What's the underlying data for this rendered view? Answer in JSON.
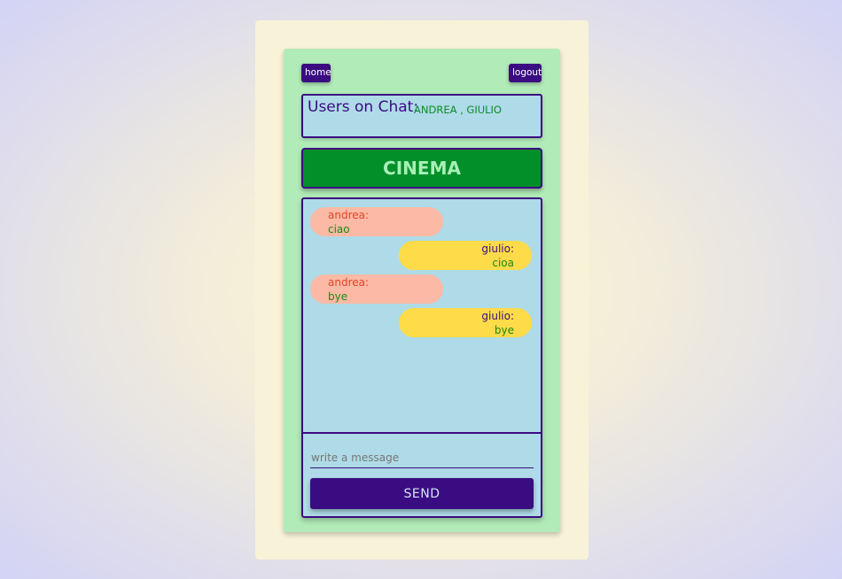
{
  "nav": {
    "home_label": "home",
    "logout_label": "logout"
  },
  "users": {
    "label": "Users on Chat:",
    "list": "ANDREA , GIULIO"
  },
  "room": {
    "name": "CINEMA"
  },
  "messages": [
    {
      "sender": "andrea:",
      "text": "ciao",
      "side": "left"
    },
    {
      "sender": "giulio:",
      "text": "cioa",
      "side": "right"
    },
    {
      "sender": "andrea:",
      "text": "bye",
      "side": "left"
    },
    {
      "sender": "giulio:",
      "text": "bye",
      "side": "right"
    }
  ],
  "composer": {
    "placeholder": "write a message",
    "value": "",
    "send_label": "SEND"
  },
  "colors": {
    "primary": "#3a0c81",
    "panel": "#b1ebb8",
    "chat_bg": "#aedbe7",
    "room_banner": "#028f2a",
    "msg_left": "#fcb9a5",
    "msg_right": "#fedb48"
  }
}
